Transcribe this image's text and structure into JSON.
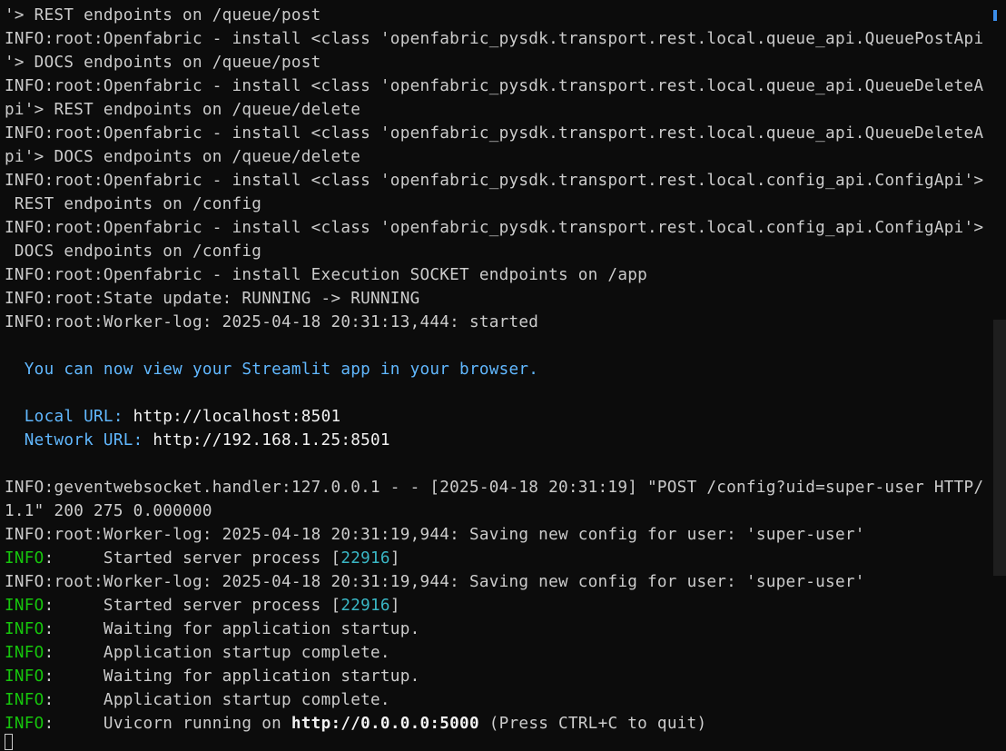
{
  "terminal": {
    "lines": [
      {
        "segments": [
          {
            "text": "'> REST endpoints on /queue/post",
            "cls": "fg"
          }
        ]
      },
      {
        "segments": [
          {
            "text": "INFO:root:Openfabric - install <class 'openfabric_pysdk.transport.rest.local.queue_api.QueuePostApi",
            "cls": "fg"
          }
        ]
      },
      {
        "segments": [
          {
            "text": "'> DOCS endpoints on /queue/post",
            "cls": "fg"
          }
        ]
      },
      {
        "segments": [
          {
            "text": "INFO:root:Openfabric - install <class 'openfabric_pysdk.transport.rest.local.queue_api.QueueDeleteA",
            "cls": "fg"
          }
        ]
      },
      {
        "segments": [
          {
            "text": "pi'> REST endpoints on /queue/delete",
            "cls": "fg"
          }
        ]
      },
      {
        "segments": [
          {
            "text": "INFO:root:Openfabric - install <class 'openfabric_pysdk.transport.rest.local.queue_api.QueueDeleteA",
            "cls": "fg"
          }
        ]
      },
      {
        "segments": [
          {
            "text": "pi'> DOCS endpoints on /queue/delete",
            "cls": "fg"
          }
        ]
      },
      {
        "segments": [
          {
            "text": "INFO:root:Openfabric - install <class 'openfabric_pysdk.transport.rest.local.config_api.ConfigApi'>",
            "cls": "fg"
          }
        ]
      },
      {
        "segments": [
          {
            "text": " REST endpoints on /config",
            "cls": "fg"
          }
        ]
      },
      {
        "segments": [
          {
            "text": "INFO:root:Openfabric - install <class 'openfabric_pysdk.transport.rest.local.config_api.ConfigApi'>",
            "cls": "fg"
          }
        ]
      },
      {
        "segments": [
          {
            "text": " DOCS endpoints on /config",
            "cls": "fg"
          }
        ]
      },
      {
        "segments": [
          {
            "text": "INFO:root:Openfabric - install Execution SOCKET endpoints on /app",
            "cls": "fg"
          }
        ]
      },
      {
        "segments": [
          {
            "text": "INFO:root:State update: RUNNING -> RUNNING",
            "cls": "fg"
          }
        ]
      },
      {
        "segments": [
          {
            "text": "INFO:root:Worker-log: 2025-04-18 20:31:13,444: started",
            "cls": "fg"
          }
        ]
      },
      {
        "segments": []
      },
      {
        "segments": [
          {
            "text": "  You can now view your Streamlit app in your browser.",
            "cls": "cyan"
          }
        ]
      },
      {
        "segments": []
      },
      {
        "segments": [
          {
            "text": "  Local URL: ",
            "cls": "cyan"
          },
          {
            "text": "http://localhost:8501",
            "cls": "white"
          }
        ]
      },
      {
        "segments": [
          {
            "text": "  Network URL: ",
            "cls": "cyan"
          },
          {
            "text": "http://192.168.1.25:8501",
            "cls": "white"
          }
        ]
      },
      {
        "segments": []
      },
      {
        "segments": [
          {
            "text": "INFO:geventwebsocket.handler:127.0.0.1 - - [2025-04-18 20:31:19] \"POST /config?uid=super-user HTTP/",
            "cls": "fg"
          }
        ]
      },
      {
        "segments": [
          {
            "text": "1.1\" 200 275 0.000000",
            "cls": "fg"
          }
        ]
      },
      {
        "segments": [
          {
            "text": "INFO:root:Worker-log: 2025-04-18 20:31:19,944: Saving new config for user: 'super-user'",
            "cls": "fg"
          }
        ]
      },
      {
        "segments": [
          {
            "text": "INFO",
            "cls": "green"
          },
          {
            "text": ":     Started server process [",
            "cls": "fg"
          },
          {
            "text": "22916",
            "cls": "teal"
          },
          {
            "text": "]",
            "cls": "fg"
          }
        ]
      },
      {
        "segments": [
          {
            "text": "INFO:root:Worker-log: 2025-04-18 20:31:19,944: Saving new config for user: 'super-user'",
            "cls": "fg"
          }
        ]
      },
      {
        "segments": [
          {
            "text": "INFO",
            "cls": "green"
          },
          {
            "text": ":     Started server process [",
            "cls": "fg"
          },
          {
            "text": "22916",
            "cls": "teal"
          },
          {
            "text": "]",
            "cls": "fg"
          }
        ]
      },
      {
        "segments": [
          {
            "text": "INFO",
            "cls": "green"
          },
          {
            "text": ":     Waiting for application startup.",
            "cls": "fg"
          }
        ]
      },
      {
        "segments": [
          {
            "text": "INFO",
            "cls": "green"
          },
          {
            "text": ":     Application startup complete.",
            "cls": "fg"
          }
        ]
      },
      {
        "segments": [
          {
            "text": "INFO",
            "cls": "green"
          },
          {
            "text": ":     Waiting for application startup.",
            "cls": "fg"
          }
        ]
      },
      {
        "segments": [
          {
            "text": "INFO",
            "cls": "green"
          },
          {
            "text": ":     Application startup complete.",
            "cls": "fg"
          }
        ]
      },
      {
        "segments": [
          {
            "text": "INFO",
            "cls": "green"
          },
          {
            "text": ":     Uvicorn running on ",
            "cls": "fg"
          },
          {
            "text": "http://0.0.0.0:5000",
            "cls": "bold"
          },
          {
            "text": " (Press CTRL+C to quit)",
            "cls": "fg"
          }
        ]
      }
    ]
  },
  "colors": {
    "background": "#0c0c0c",
    "foreground": "#cccccc",
    "cyan": "#61b8ff",
    "green": "#16c60c",
    "teal": "#3ab7c5"
  }
}
